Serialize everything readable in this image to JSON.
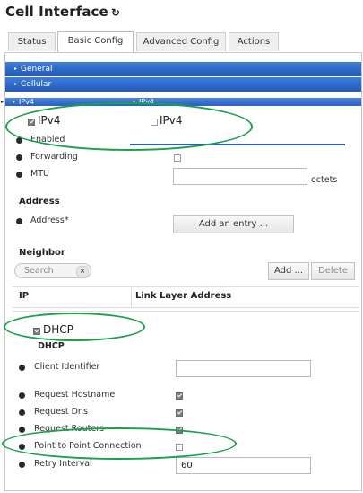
{
  "page": {
    "title": "Cell Interface",
    "refresh_glyph": "↻"
  },
  "tabs": [
    {
      "label": "Status"
    },
    {
      "label": "Basic Config"
    },
    {
      "label": "Advanced Config"
    },
    {
      "label": "Actions"
    }
  ],
  "bars": {
    "general": "General",
    "cellular": "Cellular",
    "ipv4_left": "IPv4",
    "ipv4_right": "IPv4"
  },
  "ipv4": {
    "checkbox_label_checked": "IPv4",
    "checkbox_label_unchecked": "IPv4",
    "enabled": "Enabled",
    "forwarding": "Forwarding",
    "mtu": "MTU",
    "mtu_value": "",
    "mtu_unit": "octets"
  },
  "address": {
    "section": "Address",
    "label": "Address*",
    "add_entry": "Add an entry ..."
  },
  "neighbor": {
    "section": "Neighbor",
    "search_placeholder": "Search",
    "clear_glyph": "×",
    "add": "Add ...",
    "delete": "Delete",
    "columns": [
      "IP",
      "Link Layer Address"
    ]
  },
  "dhcp": {
    "checkbox_label": "DHCP",
    "section": "DHCP",
    "client_identifier": "Client Identifier",
    "client_identifier_value": "",
    "request_hostname": "Request Hostname",
    "request_dns": "Request Dns",
    "request_routers": "Request Routers",
    "point_to_point": "Point to Point Connection",
    "retry_interval": "Retry Interval",
    "retry_interval_value": "60"
  },
  "checks": {
    "ipv4_left": true,
    "ipv4_right": false,
    "forwarding": false,
    "dhcp": true,
    "request_hostname": true,
    "request_dns": true,
    "request_routers": true,
    "point_to_point": false
  },
  "colors": {
    "bar": "#2b62c2",
    "highlight": "#1aa24a"
  }
}
